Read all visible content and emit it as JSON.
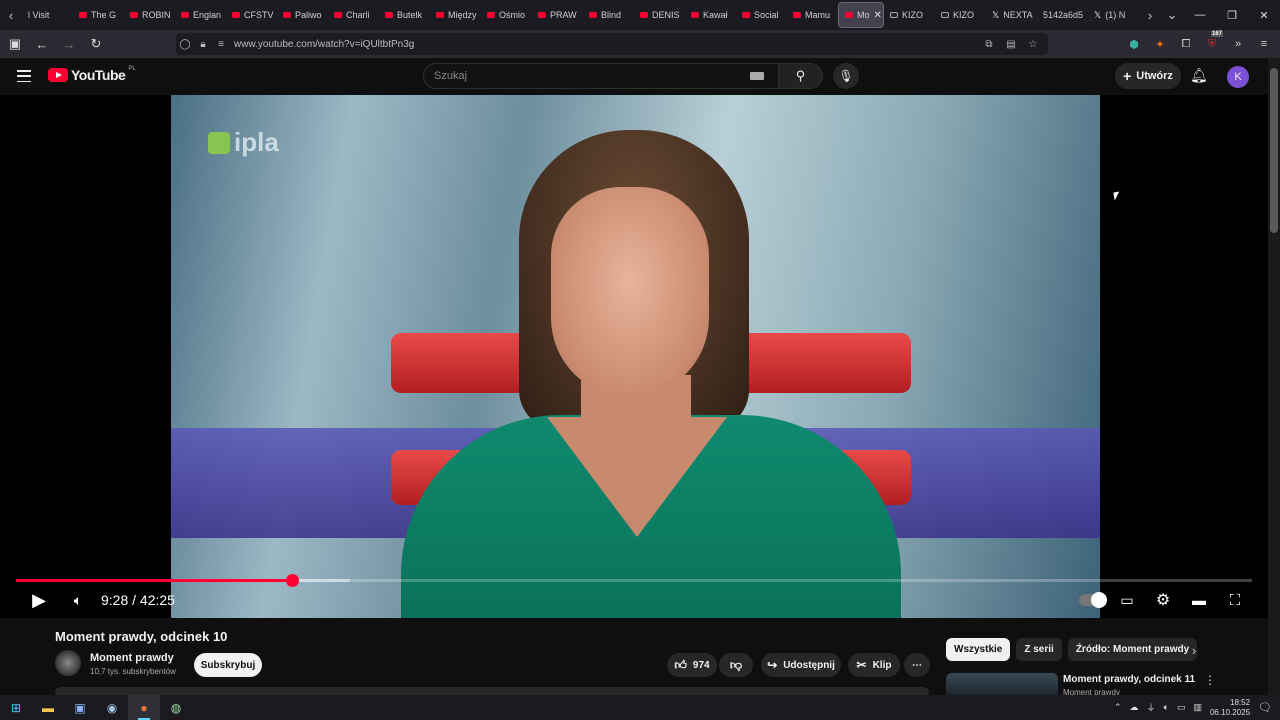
{
  "browser": {
    "tabs": [
      {
        "label": "l Visit",
        "icon": "none"
      },
      {
        "label": "The G",
        "icon": "youtube"
      },
      {
        "label": "ROBIN",
        "icon": "youtube"
      },
      {
        "label": "Englan",
        "icon": "youtube"
      },
      {
        "label": "CFSTV",
        "icon": "youtube"
      },
      {
        "label": "Paliwo",
        "icon": "youtube"
      },
      {
        "label": "Charli",
        "icon": "youtube"
      },
      {
        "label": "Butelk",
        "icon": "youtube"
      },
      {
        "label": "Między",
        "icon": "youtube"
      },
      {
        "label": "Ośmio",
        "icon": "youtube"
      },
      {
        "label": "PRAW",
        "icon": "youtube"
      },
      {
        "label": "Blind",
        "icon": "youtube"
      },
      {
        "label": "DENIS",
        "icon": "youtube"
      },
      {
        "label": "Kawał",
        "icon": "youtube"
      },
      {
        "label": "Social",
        "icon": "youtube"
      },
      {
        "label": "Mamu",
        "icon": "youtube"
      },
      {
        "label": "Mo",
        "icon": "youtube",
        "active": true
      },
      {
        "label": "KIZO",
        "icon": "tiktok"
      },
      {
        "label": "KIZO",
        "icon": "tiktok"
      },
      {
        "label": "NEXTA",
        "icon": "x"
      },
      {
        "label": "5142a6d5",
        "icon": "none"
      },
      {
        "label": "(1) N",
        "icon": "x"
      }
    ],
    "url": "www.youtube.com/watch?v=iQUltbtPn3g",
    "extension_badge": "167"
  },
  "youtube": {
    "logo_text": "YouTube",
    "country_code": "PL",
    "search_placeholder": "Szukaj",
    "create_label": "Utwórz",
    "avatar_letter": "K"
  },
  "player": {
    "watermark": "ipla",
    "current_time": "9:28",
    "duration": "42:25",
    "time_display": "9:28 / 42:25",
    "progress_fraction": 0.223,
    "buffered_fraction": 0.27
  },
  "video": {
    "title": "Moment prawdy, odcinek 10",
    "channel_name": "Moment prawdy",
    "subscribers": "10,7 tys. subskrybentów",
    "subscribe_label": "Subskrybuj",
    "likes": "974",
    "share_label": "Udostępnij",
    "clip_label": "Klip"
  },
  "sidebar": {
    "chips": [
      {
        "label": "Wszystkie",
        "active": true
      },
      {
        "label": "Z serii",
        "active": false
      },
      {
        "label": "Źródło: Moment prawdy",
        "active": false
      }
    ],
    "recommendation": {
      "title": "Moment prawdy, odcinek 11",
      "channel": "Moment prawdy"
    }
  },
  "taskbar": {
    "time": "18:52",
    "date": "06.10.2025"
  },
  "colors": {
    "accent": "#ff0033",
    "background": "#0f0f0f"
  }
}
